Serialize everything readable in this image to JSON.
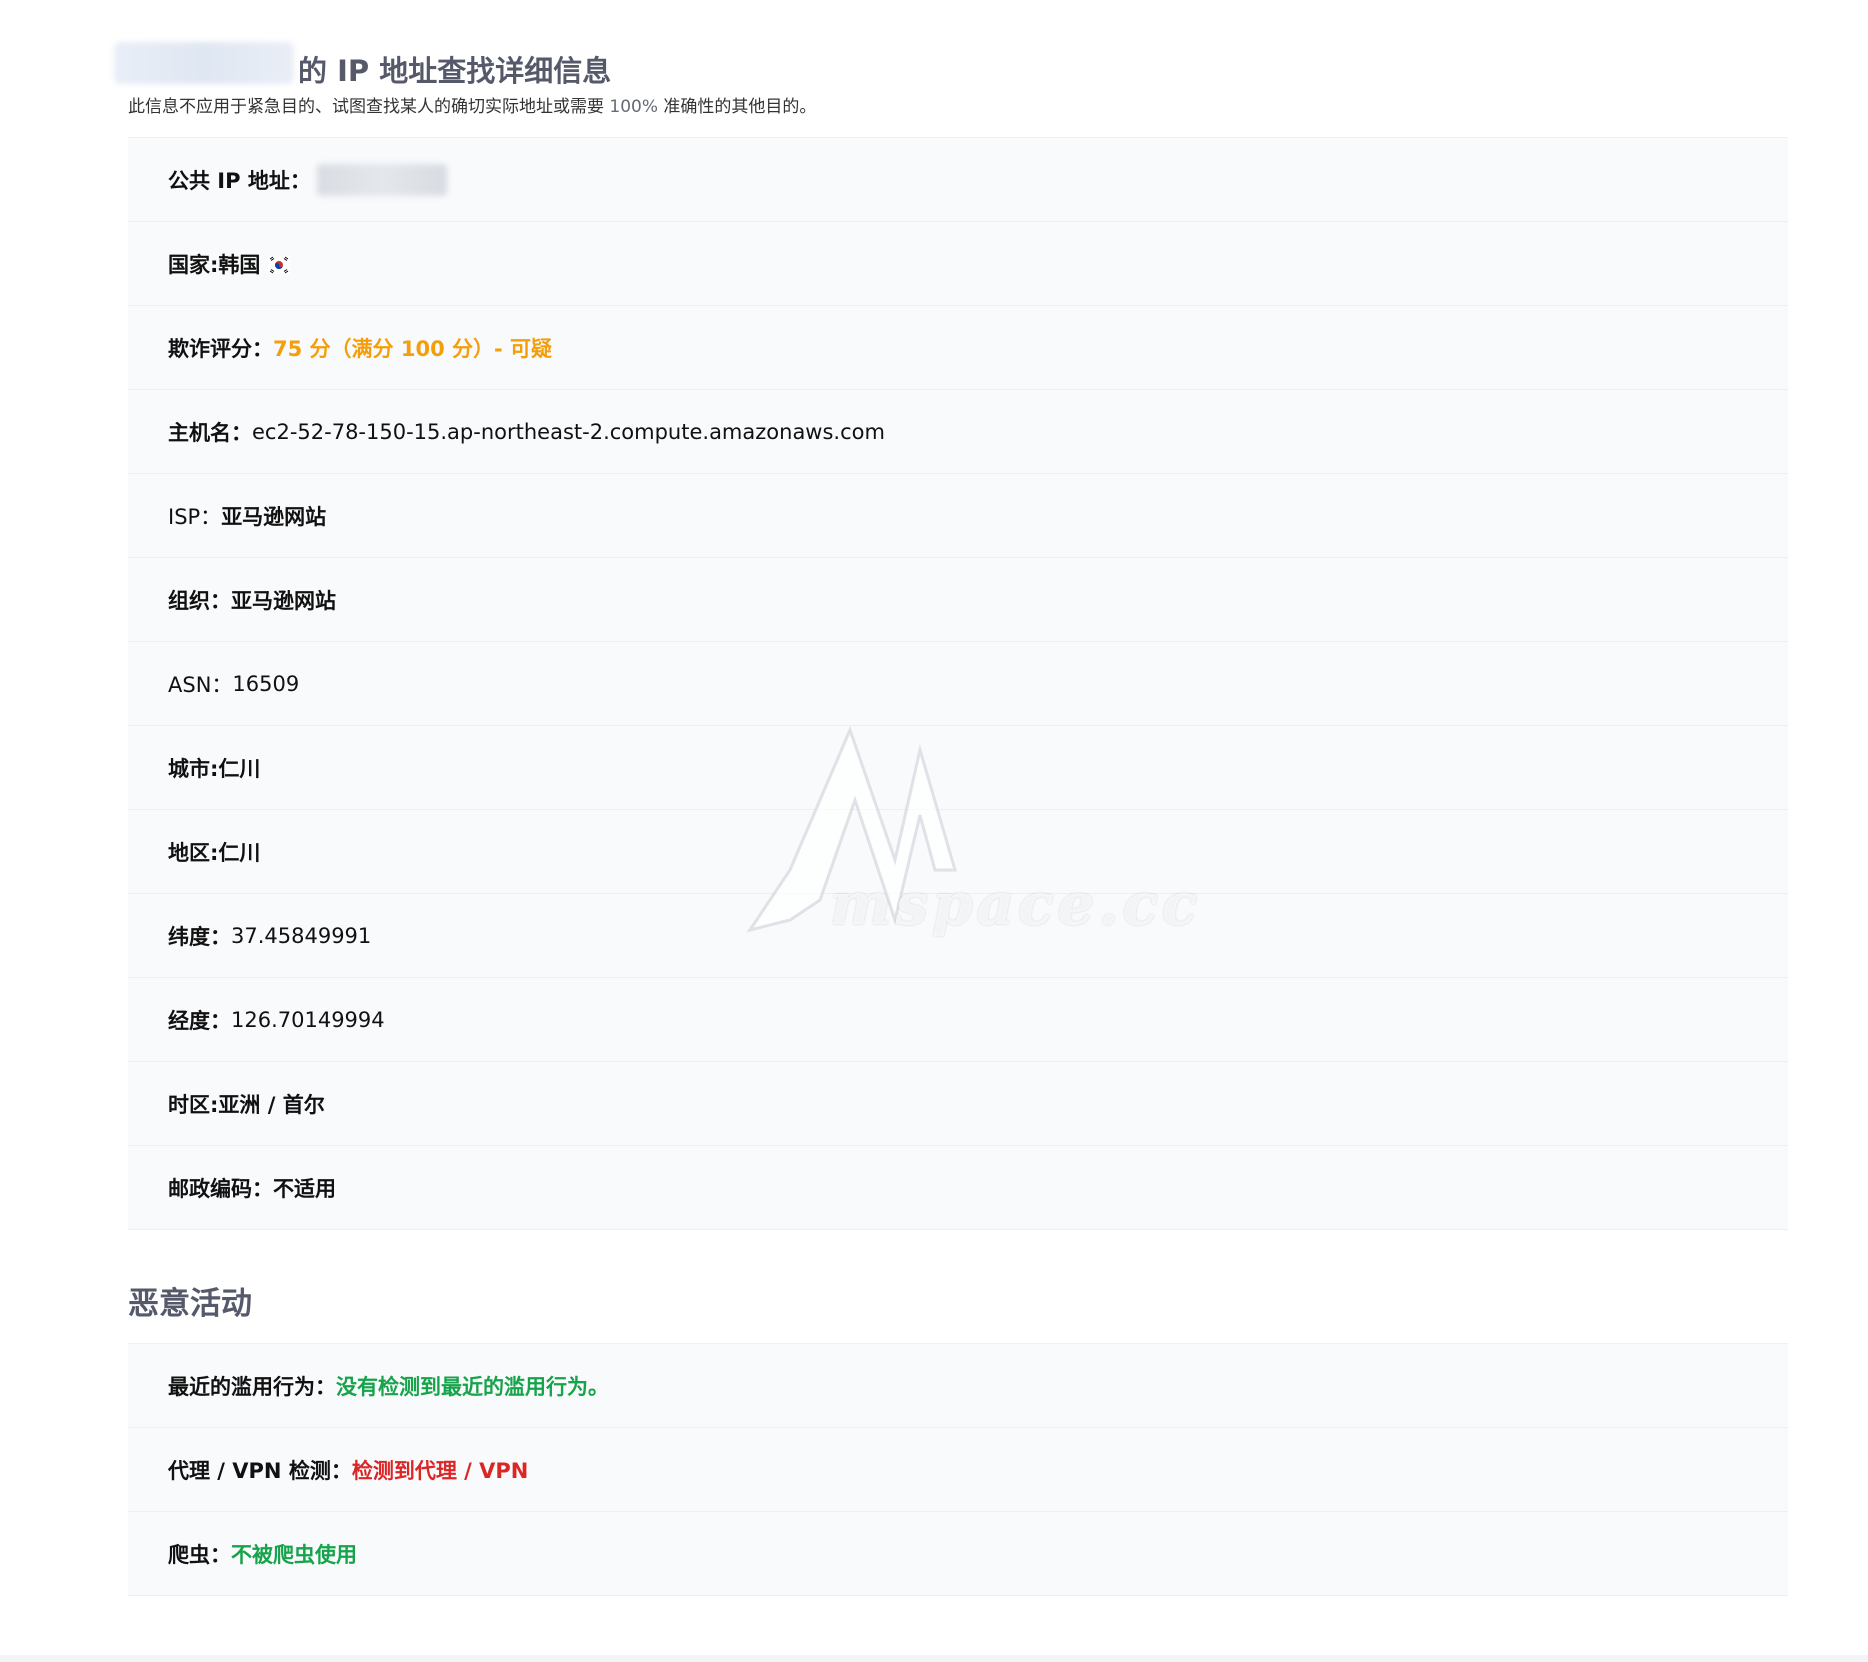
{
  "header": {
    "title": "的 IP 地址查找详细信息",
    "disclaimer_before": "此信息不应用于紧急目的、试图查找某人的确切实际地址或需要 ",
    "disclaimer_percent": "100%",
    "disclaimer_after": " 准确性的其他目的。"
  },
  "details": {
    "public_ip_label": "公共 IP 地址：",
    "country_label": "国家:",
    "country_value": "韩国",
    "fraud_label": "欺诈评分：",
    "fraud_value": "75 分（满分 100 分）- 可疑",
    "hostname_label": "主机名：",
    "hostname_value": "ec2-52-78-150-15.ap-northeast-2.compute.amazonaws.com",
    "isp_label": "ISP：",
    "isp_value": "亚马逊网站",
    "org_label": "组织：",
    "org_value": "亚马逊网站",
    "asn_label": "ASN：",
    "asn_value": "16509",
    "city_label": "城市:",
    "city_value": "仁川",
    "region_label": "地区:",
    "region_value": "仁川",
    "latitude_label": "纬度：",
    "latitude_value": "37.45849991",
    "longitude_label": "经度：",
    "longitude_value": "126.70149994",
    "timezone_label": "时区:",
    "timezone_value": "亚洲 / 首尔",
    "postal_label": "邮政编码：",
    "postal_value": "不适用"
  },
  "malicious": {
    "title": "恶意活动",
    "abuse_label": "最近的滥用行为：",
    "abuse_value": "没有检测到最近的滥用行为。",
    "proxy_label": "代理 / VPN 检测：",
    "proxy_value": "检测到代理 / VPN",
    "crawler_label": "爬虫：",
    "crawler_value": "不被爬虫使用"
  },
  "watermark": {
    "text": "mspace.cc"
  },
  "colors": {
    "warning": "#f59e0b",
    "success": "#16a34a",
    "danger": "#dc2626",
    "heading": "#55596a",
    "row_background": "#f8fafc"
  },
  "icons": {
    "country_flag": "south-korea-flag-icon"
  }
}
